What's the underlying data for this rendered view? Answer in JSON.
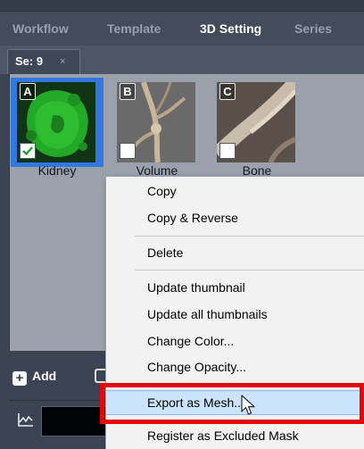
{
  "tabs": [
    {
      "label": "Workflow"
    },
    {
      "label": "Template"
    },
    {
      "label": "3D Setting",
      "active": true
    },
    {
      "label": "Series"
    }
  ],
  "series_tab": {
    "label": "Se: 9",
    "close": "×"
  },
  "thumbnails": [
    {
      "letter": "A",
      "label": "Kidney",
      "checked": true,
      "selected": true
    },
    {
      "letter": "B",
      "label": "Volume",
      "checked": false,
      "selected": false
    },
    {
      "letter": "C",
      "label": "Bone",
      "checked": false,
      "selected": false
    }
  ],
  "bottom": {
    "add_label": "Add"
  },
  "context_menu": {
    "items": [
      {
        "label": "Copy"
      },
      {
        "label": "Copy & Reverse"
      },
      {
        "label": "Delete"
      },
      {
        "label": "Update thumbnail"
      },
      {
        "label": "Update all thumbnails"
      },
      {
        "label": "Change Color..."
      },
      {
        "label": "Change Opacity..."
      },
      {
        "label": "Export as Mesh...",
        "hovered": true
      },
      {
        "label": "Register as Excluded Mask"
      }
    ]
  },
  "colors": {
    "accent_selection": "#3378e0",
    "highlight_box": "#e3070b",
    "menu_hover": "#cce4fb"
  },
  "icons": [
    "close-icon",
    "check-icon",
    "plus-icon",
    "chart-icon",
    "mouse-cursor-icon"
  ]
}
